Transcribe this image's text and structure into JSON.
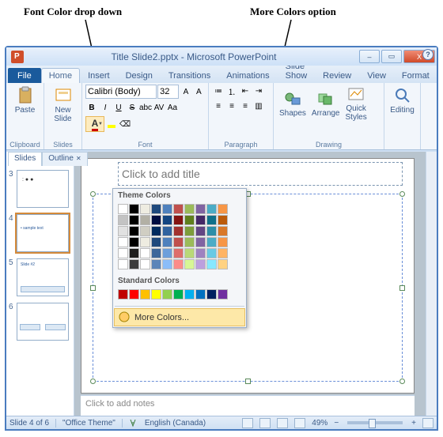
{
  "annotations": {
    "font_color": "Font Color drop down",
    "more_colors": "More Colors option"
  },
  "window": {
    "title": "Title Slide2.pptx - Microsoft PowerPoint",
    "min": "–",
    "max": "▭",
    "close": "X",
    "help": "?"
  },
  "tabs": [
    "File",
    "Home",
    "Insert",
    "Design",
    "Transitions",
    "Animations",
    "Slide Show",
    "Review",
    "View",
    "Format"
  ],
  "active_tab": "Home",
  "ribbon": {
    "clipboard": {
      "paste": "Paste",
      "group": "Clipboard"
    },
    "slides": {
      "new": "New\nSlide",
      "group": "Slides"
    },
    "font": {
      "name": "Calibri (Body)",
      "size": "32",
      "group": "Font"
    },
    "paragraph": {
      "group": "Paragraph"
    },
    "drawing": {
      "shapes": "Shapes",
      "arrange": "Arrange",
      "quick": "Quick\nStyles",
      "group": "Drawing"
    },
    "editing": {
      "label": "Editing"
    }
  },
  "color_dropdown": {
    "theme_label": "Theme Colors",
    "standard_label": "Standard Colors",
    "more_colors": "More Colors...",
    "theme_row": [
      "#ffffff",
      "#000000",
      "#eeece1",
      "#1f497d",
      "#4f81bd",
      "#c0504d",
      "#9bbb59",
      "#8064a2",
      "#4bacc6",
      "#f79646"
    ],
    "standard_row": [
      "#c00000",
      "#ff0000",
      "#ffc000",
      "#ffff00",
      "#92d050",
      "#00b050",
      "#00b0f0",
      "#0070c0",
      "#002060",
      "#7030a0"
    ]
  },
  "panel_tabs": {
    "slides": "Slides",
    "outline": "Outline"
  },
  "thumbs": [
    {
      "n": "3"
    },
    {
      "n": "4",
      "sel": true
    },
    {
      "n": "5"
    },
    {
      "n": "6"
    }
  ],
  "slide": {
    "title_placeholder": "Click to add title"
  },
  "notes": {
    "placeholder": "Click to add notes"
  },
  "status": {
    "slide": "Slide 4 of 6",
    "theme": "\"Office Theme\"",
    "lang": "English (Canada)",
    "zoom": "49%"
  }
}
